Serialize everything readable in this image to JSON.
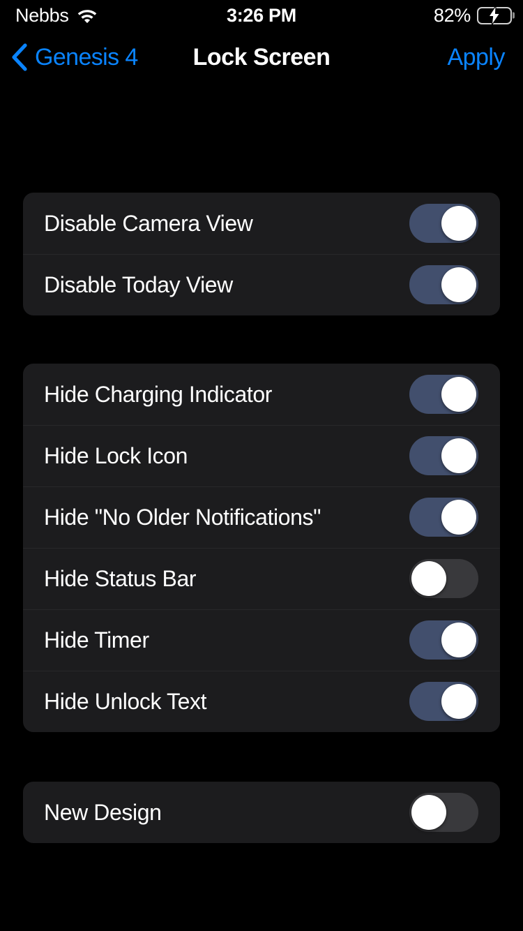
{
  "status_bar": {
    "carrier": "Nebbs",
    "wifi_icon": "wifi-icon",
    "time": "3:26 PM",
    "battery_percent": "82%",
    "battery_level": 82,
    "battery_charging": true,
    "battery_icon": "battery-charging-icon",
    "battery_color": "#32d74b"
  },
  "nav_bar": {
    "back_icon": "chevron-left-icon",
    "back_label": "Genesis 4",
    "title": "Lock Screen",
    "action_label": "Apply",
    "accent_color": "#0a84ff"
  },
  "theme": {
    "background": "#000000",
    "card_background": "#1c1c1e",
    "toggle_on_color": "#424f6d",
    "toggle_off_color": "#39393c",
    "knob_color": "#ffffff",
    "text_color": "#ffffff"
  },
  "groups": [
    {
      "id": "view-options",
      "rows": [
        {
          "label": "Disable Camera View",
          "value": true
        },
        {
          "label": "Disable Today View",
          "value": true
        }
      ]
    },
    {
      "id": "hide-options",
      "rows": [
        {
          "label": "Hide Charging Indicator",
          "value": true
        },
        {
          "label": "Hide Lock Icon",
          "value": true
        },
        {
          "label": "Hide \"No Older Notifications\"",
          "value": true
        },
        {
          "label": "Hide Status Bar",
          "value": false
        },
        {
          "label": "Hide Timer",
          "value": true
        },
        {
          "label": "Hide Unlock Text",
          "value": true
        }
      ]
    },
    {
      "id": "design-options",
      "rows": [
        {
          "label": "New Design",
          "value": false
        }
      ]
    }
  ]
}
